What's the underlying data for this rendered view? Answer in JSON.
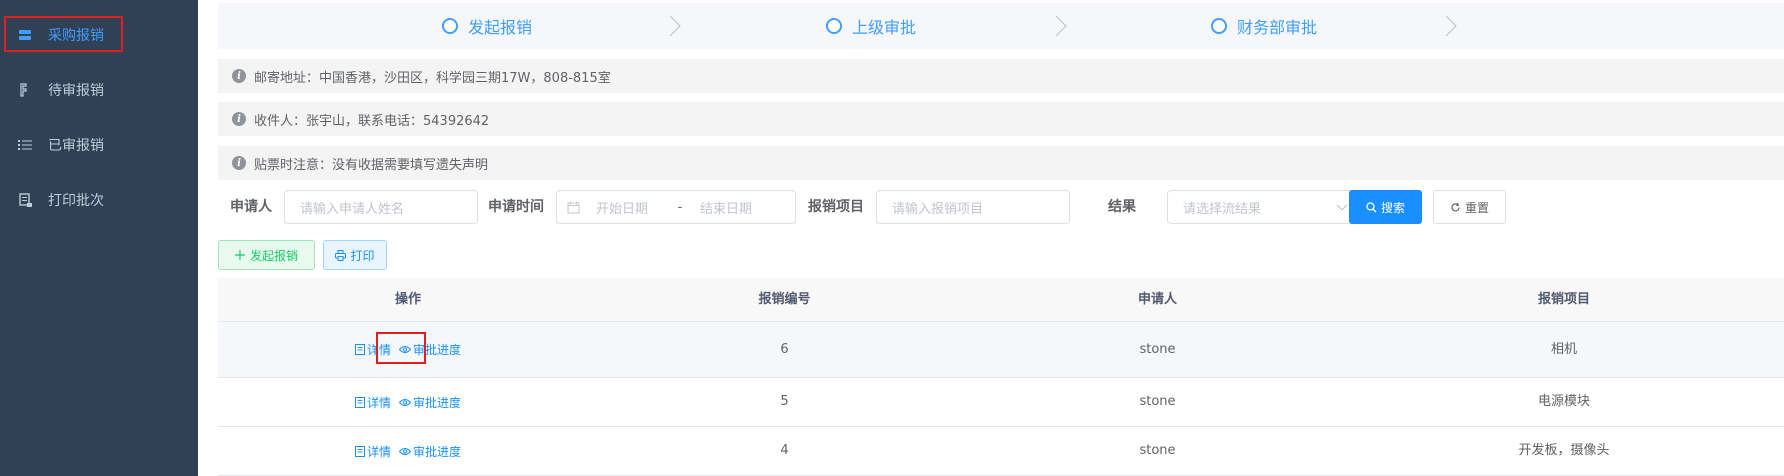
{
  "sidebar": {
    "items": [
      {
        "label": "采购报销",
        "icon": "receipt-icon",
        "active": true
      },
      {
        "label": "待审报销",
        "icon": "pending-doc-icon",
        "active": false
      },
      {
        "label": "已审报销",
        "icon": "list-icon",
        "active": false
      },
      {
        "label": "打印批次",
        "icon": "print-batch-icon",
        "active": false
      }
    ]
  },
  "steps": [
    {
      "label": "发起报销"
    },
    {
      "label": "上级审批"
    },
    {
      "label": "财务部审批"
    }
  ],
  "info": {
    "address": "邮寄地址：中国香港，沙田区，科学园三期17W，808-815室",
    "recipient": "收件人：张宇山，联系电话：54392642",
    "note": "贴票时注意：没有收据需要填写遗失声明"
  },
  "filters": {
    "applicant_label": "申请人",
    "applicant_placeholder": "请输入申请人姓名",
    "time_label": "申请时间",
    "start_placeholder": "开始日期",
    "range_separator": "-",
    "end_placeholder": "结束日期",
    "item_label": "报销项目",
    "item_placeholder": "请输入报销项目",
    "result_label": "结果",
    "result_placeholder": "请选择流结果",
    "search_label": "搜索",
    "reset_label": "重置"
  },
  "actions": {
    "create_label": "发起报销",
    "print_label": "打印"
  },
  "table": {
    "headers": [
      "操作",
      "报销编号",
      "申请人",
      "报销项目"
    ],
    "detail_label": "详情",
    "progress_label": "审批进度",
    "rows": [
      {
        "id": "6",
        "applicant": "stone",
        "item": "相机"
      },
      {
        "id": "5",
        "applicant": "stone",
        "item": "电源模块"
      },
      {
        "id": "4",
        "applicant": "stone",
        "item": "开发板，摄像头"
      }
    ]
  },
  "colors": {
    "sidebar_bg": "#304156",
    "sidebar_text": "#bfcbd9",
    "primary": "#1890ff",
    "active": "#409eff",
    "success": "#13ce66",
    "highlight_box": "#e02020"
  }
}
